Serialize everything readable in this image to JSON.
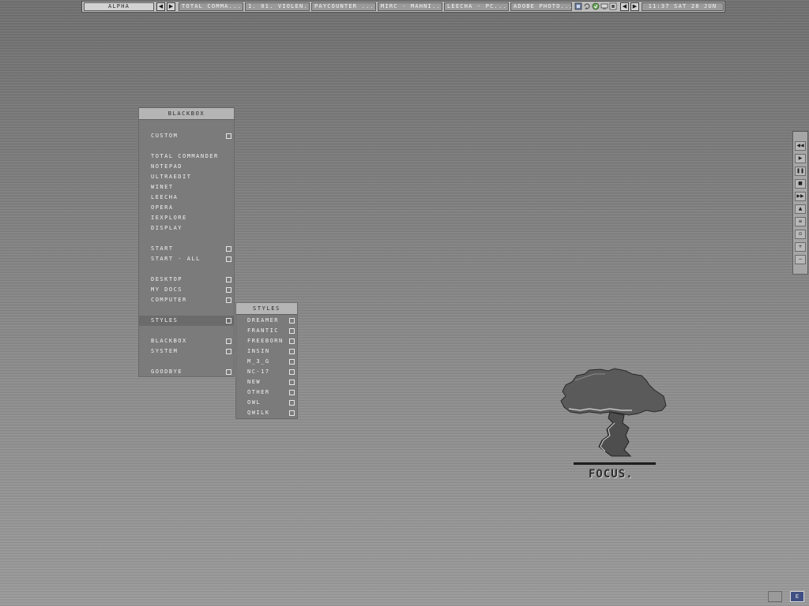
{
  "toolbar": {
    "workspace": "ALPHA",
    "tasks": [
      "TOTAL COMMA...",
      "1. 01. VIOLEN...",
      "PAYCOUNTER ...",
      "MIRC - MAHNI...",
      "LEECHA - PC...",
      "ADOBE PHOTO..."
    ],
    "clock": "11:37 SAT 28 JUN",
    "nav_prev": "◀",
    "nav_next": "▶"
  },
  "main_menu": {
    "title": "BLACKBOX",
    "items": [
      {
        "label": "CUSTOM",
        "submenu": true
      },
      {
        "label": "TOTAL COMMANDER",
        "submenu": false
      },
      {
        "label": "NOTEPAD",
        "submenu": false
      },
      {
        "label": "ULTRAEDIT",
        "submenu": false
      },
      {
        "label": "WINET",
        "submenu": false
      },
      {
        "label": "LEECHA",
        "submenu": false
      },
      {
        "label": "OPERA",
        "submenu": false
      },
      {
        "label": "IEXPLORE",
        "submenu": false
      },
      {
        "label": "DISPLAY",
        "submenu": false
      },
      {
        "label": "START",
        "submenu": true
      },
      {
        "label": "START - ALL",
        "submenu": true
      },
      {
        "label": "DESKTOP",
        "submenu": true
      },
      {
        "label": "MY DOCS",
        "submenu": true
      },
      {
        "label": "COMPUTER",
        "submenu": true
      },
      {
        "label": "STYLES",
        "submenu": true,
        "active": true
      },
      {
        "label": "BLACKBOX",
        "submenu": true
      },
      {
        "label": "SYSTEM",
        "submenu": true
      },
      {
        "label": "GOODBYE",
        "submenu": true
      }
    ]
  },
  "styles_menu": {
    "title": "STYLES",
    "items": [
      "DREAMER",
      "FRANTIC",
      "FREEBORN",
      "INSIN",
      "M_3_G",
      "NC-17",
      "NEW",
      "OTHER",
      "OWL",
      "QWILK"
    ]
  },
  "mediabar": {
    "buttons": [
      "◀◀",
      "▶",
      "❚❚",
      "■",
      "▶▶",
      "▲",
      "≡",
      "⊙",
      "+",
      "−"
    ]
  },
  "logo": {
    "text": "FOCUS."
  },
  "tray_bottom": {
    "selected_label": "E"
  },
  "colors": {
    "menu_bg": "#7b7b7b",
    "title_bg": "#b5b5b5",
    "desktop": "#8e8e8e"
  }
}
